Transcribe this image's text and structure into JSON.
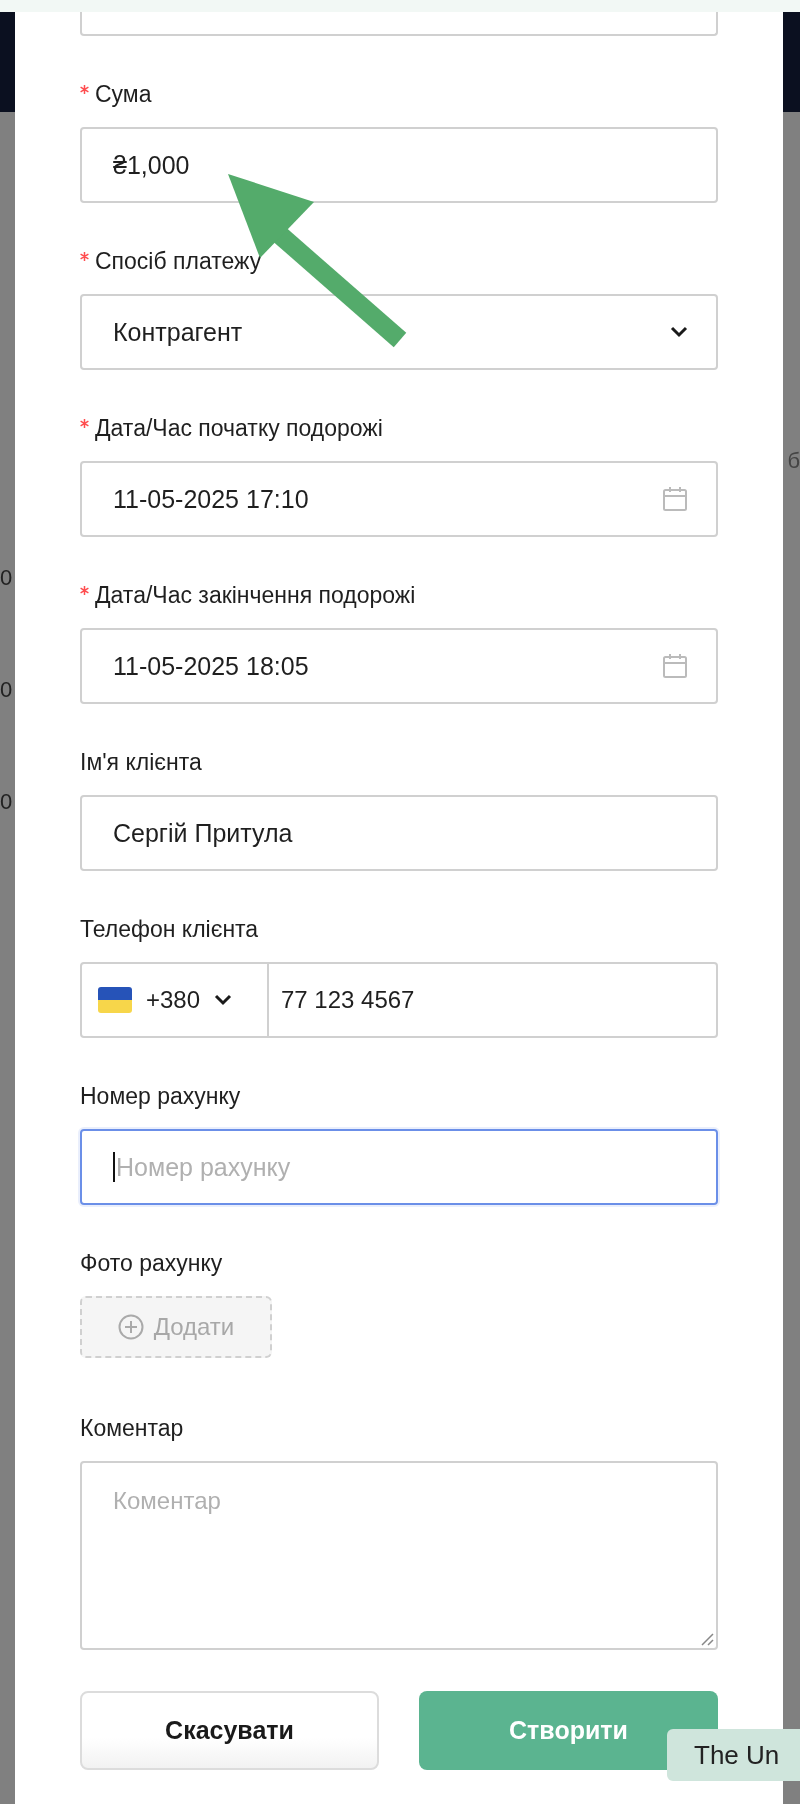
{
  "backdrop": {
    "left_fragments": [
      "0",
      "0",
      "0"
    ],
    "right_fragments": [
      "б"
    ]
  },
  "form": {
    "fields": [
      {
        "kind": "money",
        "label": "Сума",
        "required": true,
        "value": "₴1,000"
      },
      {
        "kind": "select",
        "label": "Спосіб платежу",
        "required": true,
        "value": "Контрагент"
      },
      {
        "kind": "date",
        "label": "Дата/Час початку подорожі",
        "required": true,
        "value": "11-05-2025 17:10"
      },
      {
        "kind": "date",
        "label": "Дата/Час закінчення подорожі",
        "required": true,
        "value": "11-05-2025 18:05"
      },
      {
        "kind": "text",
        "label": "Ім'я клієнта",
        "required": false,
        "value": "Сергій Притула"
      },
      {
        "kind": "phone",
        "label": "Телефон клієнта",
        "required": false,
        "country_code": "+380",
        "value": "77 123 4567"
      },
      {
        "kind": "text",
        "label": "Номер рахунку",
        "required": false,
        "placeholder": "Номер рахунку",
        "focused": true
      },
      {
        "kind": "upload",
        "label": "Фото рахунку",
        "required": false,
        "button": "Додати"
      },
      {
        "kind": "textarea",
        "label": "Коментар",
        "required": false,
        "placeholder": "Коментар"
      }
    ],
    "buttons": [
      {
        "kind": "secondary",
        "label": "Скасувати"
      },
      {
        "kind": "primary",
        "label": "Створити"
      }
    ]
  },
  "tooltip": {
    "text": "The Un"
  }
}
